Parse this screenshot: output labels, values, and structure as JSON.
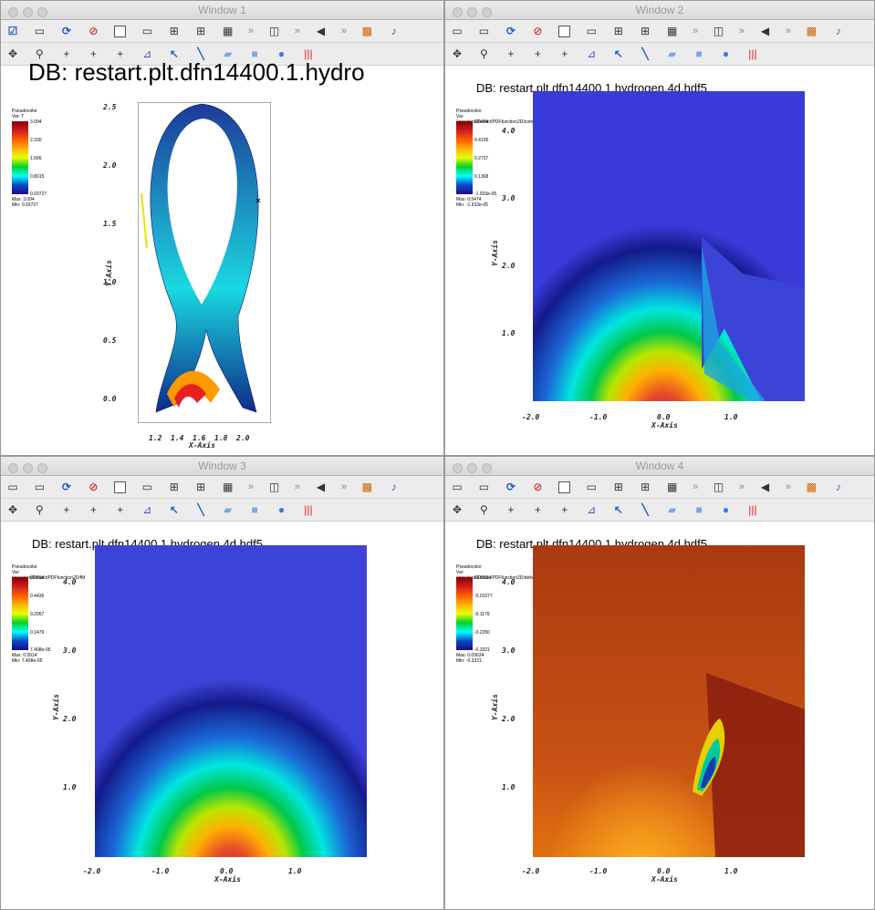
{
  "toolbar": {
    "row1_icons": [
      "active-window-icon",
      "new-window-icon",
      "refresh-icon",
      "clear-icon",
      "layout-1x1-icon",
      "layout-1x2-icon",
      "layout-2x2-icon",
      "layout-2x3-icon",
      "layout-3x3-icon",
      "overflow-icon",
      "view-3d-icon",
      "overflow-icon",
      "animation-icon",
      "overflow-icon",
      "color-map-icon",
      "tools-icon"
    ],
    "row2_icons": [
      "navigate-icon",
      "zoom-icon",
      "zone-pick-icon",
      "node-pick-icon",
      "spreadsheet-pick-icon",
      "lineout-icon",
      "point-tool-icon",
      "line-tool-icon",
      "plane-tool-icon",
      "box-tool-icon",
      "sphere-tool-icon",
      "axis-array-icon"
    ],
    "glyphs": {
      "more": "»"
    }
  },
  "windows": [
    {
      "title": "Window 1",
      "db_title": "DB: restart.plt.dfn14400.1.hydro",
      "legend": {
        "name": "Pseudocolor",
        "var": "Var: T",
        "ticks": [
          "3.094",
          "2.330",
          "1.566",
          "0.8015",
          "0.03727"
        ],
        "max": "Max: 3.094",
        "min": "Min: 0.03727"
      },
      "x_axis_label": "X-Axis",
      "y_axis_label": "Y-Axis",
      "x_ticks": [
        "1.2",
        "1.4",
        "1.6",
        "1.8",
        "2.0"
      ],
      "y_ticks": [
        "0.0",
        "0.5",
        "1.0",
        "1.5",
        "2.0",
        "2.5"
      ]
    },
    {
      "title": "Window 2",
      "db_title": "DB: restart.plt.dfn14400.1.hydrogen.4d.hdf5",
      "legend": {
        "name": "Pseudocolor",
        "var": "Var: operators/Extract/PDFfunction2D/component_0",
        "ticks": [
          "0.5474",
          "0.4105",
          "0.2737",
          "0.1368",
          "-1.933e-05"
        ],
        "max": "Max: 0.5474",
        "min": "Min: -1.933e-05"
      },
      "x_axis_label": "X-Axis",
      "y_axis_label": "Y-Axis",
      "x_ticks": [
        "-2.0",
        "-1.0",
        "0.0",
        "1.0"
      ],
      "y_ticks": [
        "1.0",
        "2.0",
        "3.0",
        "4.0"
      ]
    },
    {
      "title": "Window 3",
      "db_title": "DB: restart.plt.dfn14400.1.hydrogen.4d.hdf5",
      "legend": {
        "name": "Pseudocolor",
        "var": "Var: operators/Extract/PDFfunction2D/fM",
        "ticks": [
          "0.5914",
          "0.4436",
          "0.2957",
          "0.1479",
          "7.408e-05"
        ],
        "max": "Max: 0.5914",
        "min": "Min: 7.408e-05"
      },
      "x_axis_label": "X-Axis",
      "y_axis_label": "Y-Axis",
      "x_ticks": [
        "-2.0",
        "-1.0",
        "0.0",
        "1.0"
      ],
      "y_ticks": [
        "1.0",
        "2.0",
        "3.0",
        "4.0"
      ]
    },
    {
      "title": "Window 4",
      "db_title": "DB: restart.plt.dfn14400.1.hydrogen.4d.hdf5",
      "legend": {
        "name": "Pseudocolor",
        "var": "Var: operators/Extract/PDFfunction2D/deltaf",
        "ticks": [
          "0.09634",
          "-0.01077",
          "-0.1179",
          "-0.2250",
          "-0.3321"
        ],
        "max": "Max: 0.09634",
        "min": "Min: -0.3321"
      },
      "x_axis_label": "X-Axis",
      "y_axis_label": "Y-Axis",
      "x_ticks": [
        "-2.0",
        "-1.0",
        "0.0",
        "1.0"
      ],
      "y_ticks": [
        "1.0",
        "2.0",
        "3.0",
        "4.0"
      ]
    }
  ]
}
